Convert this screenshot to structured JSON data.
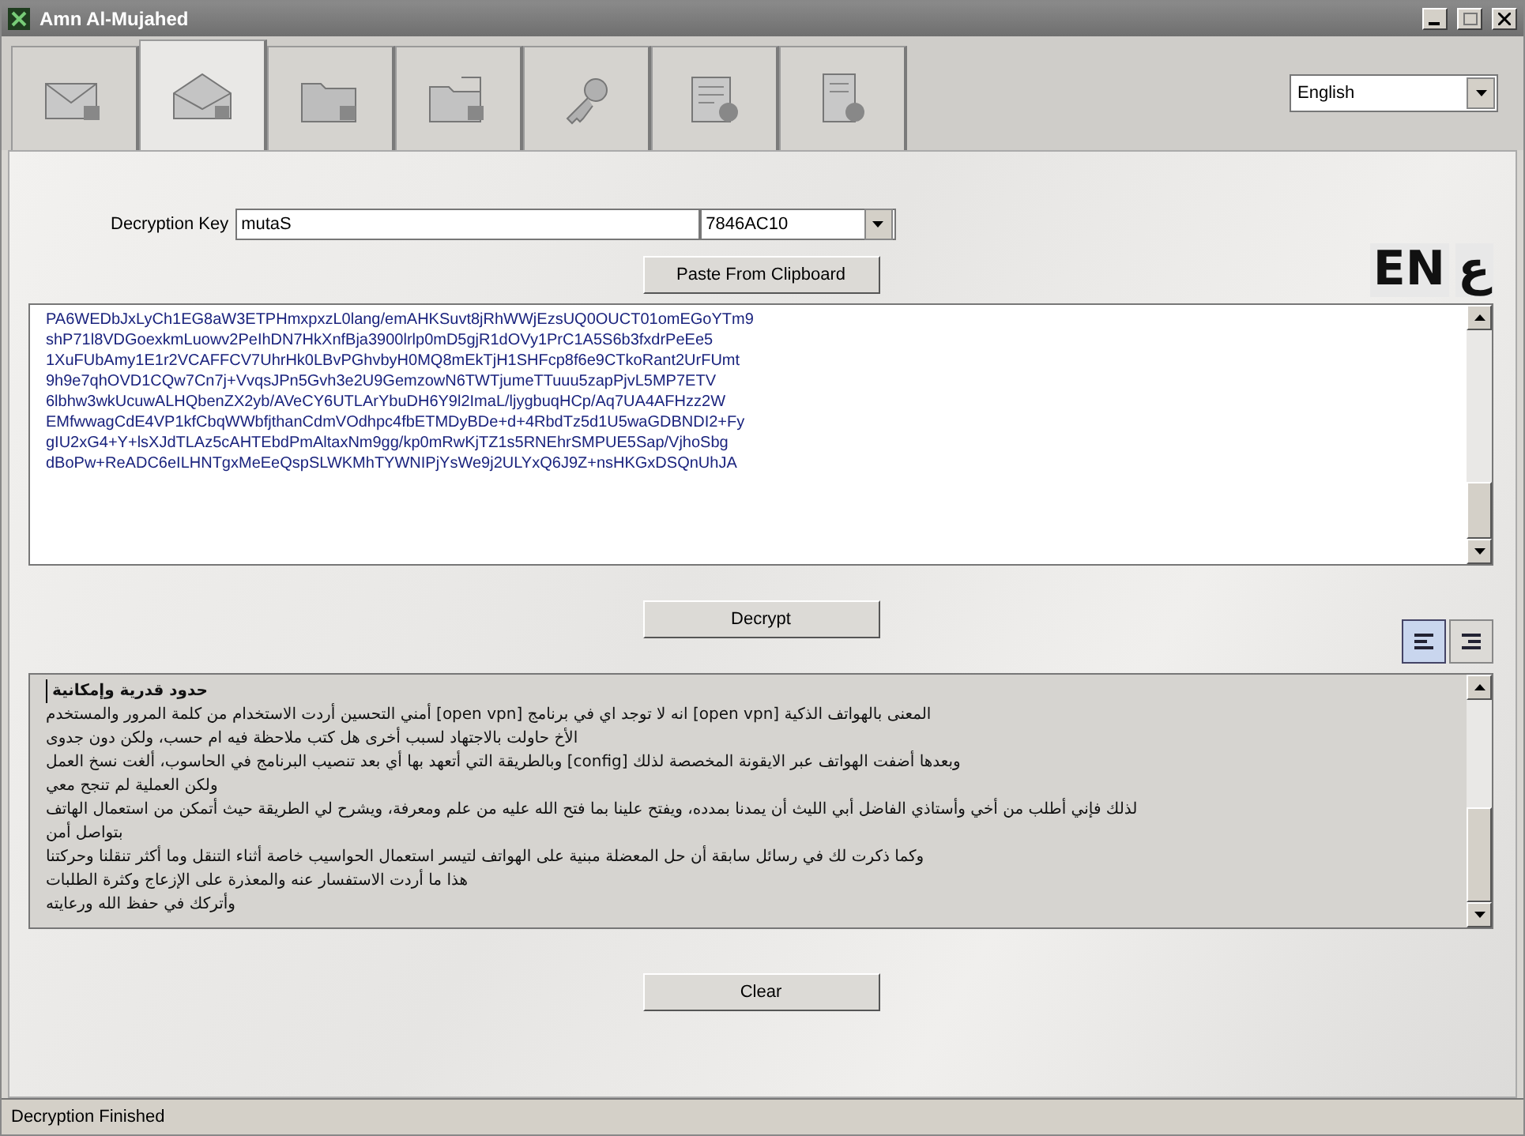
{
  "window": {
    "title": "Amn Al-Mujahed"
  },
  "tabs": [
    {
      "kind": "mail",
      "selected": false
    },
    {
      "kind": "openmail",
      "selected": true
    },
    {
      "kind": "folder",
      "selected": false
    },
    {
      "kind": "openfolder",
      "selected": false
    },
    {
      "kind": "key",
      "selected": false
    },
    {
      "kind": "settings",
      "selected": false
    },
    {
      "kind": "help",
      "selected": false
    }
  ],
  "language": {
    "value": "English"
  },
  "key": {
    "label": "Decryption Key",
    "value": "mutaS",
    "code": "7846AC10"
  },
  "paste_button": "Paste From Clipboard",
  "english_badge": "EN",
  "arabic_badge": "ع",
  "ciphertext": [
    "PA6WEDbJxLyCh1EG8aW3ETPHmxpxzL0lang/emAHKSuvt8jRhWWjEzsUQ0OUCT01omEGoYTm9",
    "shP71l8VDGoexkmLuowv2PeIhDN7HkXnfBja3900lrlp0mD5gjR1dOVy1PrC1A5S6b3fxdrPeEe5",
    "1XuFUbAmy1E1r2VCAFFCV7UhrHk0LBvPGhvbyH0MQ8mEkTjH1SHFcp8f6e9CTkoRant2UrFUmt",
    "9h9e7qhOVD1CQw7Cn7j+VvqsJPn5Gvh3e2U9GemzowN6TWTjumeTTuuu5zapPjvL5MP7ETV",
    "6lbhw3wkUcuwALHQbenZX2yb/AVeCY6UTLArYbuDH6Y9l2ImaL/ljygbuqHCp/Aq7UA4AFHzz2W",
    "EMfwwagCdE4VP1kfCbqWWbfjthanCdmVOdhpc4fbETMDyBDe+d+4RbdTz5d1U5waGDBNDI2+Fy",
    "gIU2xG4+Y+lsXJdTLAz5cAHTEbdPmAltaxNm9gg/kp0mRwKjTZ1s5RNEhrSMPUE5Sap/VjhoSbg",
    "dBoPw+ReADC6eILHNTgxMeEeQspSLWKMhTYWNIPjYsWe9j2ULYxQ6J9Z+nsHKGxDSQnUhJA"
  ],
  "decrypt_button": "Decrypt",
  "align_buttons": [
    {
      "kind": "left",
      "selected": true
    },
    {
      "kind": "right",
      "selected": false
    }
  ],
  "message": [
    "حدود قدرية وإمكانية",
    "المعنى بالهواتف الذكية [open vpn] انه لا توجد اي في برنامج [open vpn] أمني التحسين أردت الاستخدام من كلمة المرور والمستخدم",
    "الأخ حاولت بالاجتهاد لسبب أخرى هل كتب ملاحظة فيه ام حسب، ولكن دون جدوى",
    "وبعدها أضفت الهواتف عبر الايقونة المخصصة لذلك [config] وبالطريقة التي أتعهد بها أي بعد تنصيب البرنامج في الحاسوب، ألغت نسخ العمل",
    "ولكن العملية لم تنجح معي",
    "لذلك فإني أطلب من أخي وأستاذي الفاضل أبي الليث أن يمدنا بمدده، ويفتح علينا بما فتح الله عليه من علم ومعرفة، ويشرح لي الطريقة حيث أتمكن من استعمال الهاتف",
    "بتواصل أمن",
    "وكما ذكرت لك في رسائل سابقة أن حل المعضلة مبنية على الهواتف لتيسر استعمال الحواسيب خاصة أثناء التنقل وما أكثر تنقلنا وحركتنا",
    "هذا ما أردت الاستفسار عنه والمعذرة على الإزعاج وكثرة الطلبات",
    "وأتركك في حفظ الله ورعايته"
  ],
  "clear_button": "Clear",
  "status_bar": "Decryption Finished"
}
